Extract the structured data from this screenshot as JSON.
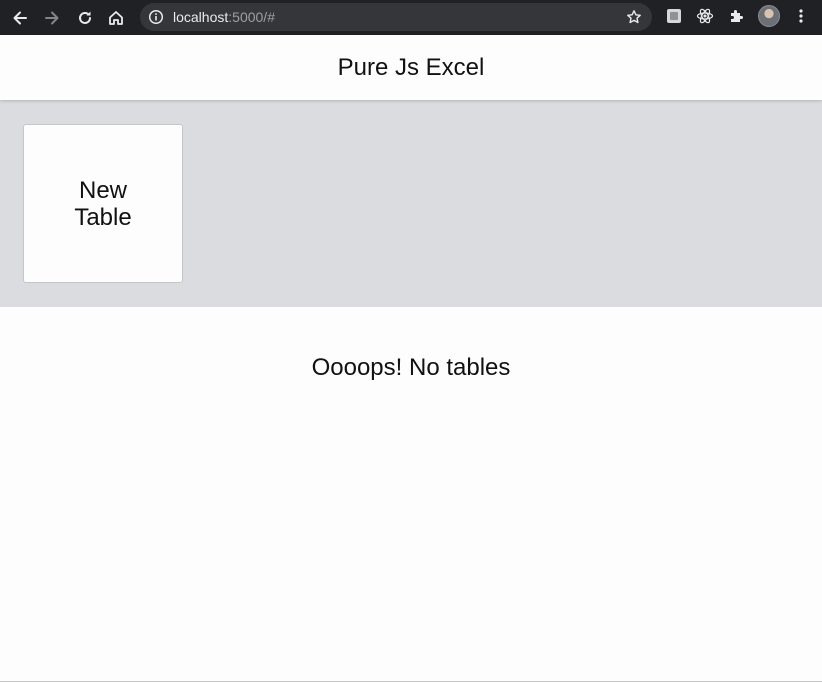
{
  "browser": {
    "url_host": "localhost",
    "url_rest": ":5000/#",
    "icons": [
      "back-arrow-icon",
      "forward-arrow-icon",
      "reload-icon",
      "home-icon",
      "info-icon",
      "star-icon",
      "extension-icon",
      "react-devtools-icon",
      "puzzle-icon",
      "profile-avatar",
      "kebab-menu-icon"
    ]
  },
  "header": {
    "title": "Pure Js Excel"
  },
  "create": {
    "new_table_label": "New Table"
  },
  "list": {
    "empty_message": "Oooops! No tables"
  },
  "colors": {
    "chrome_bg": "#202124",
    "omnibox_bg": "#35363a",
    "create_area_bg": "#dadce0",
    "page_bg": "#fdfdfd"
  }
}
